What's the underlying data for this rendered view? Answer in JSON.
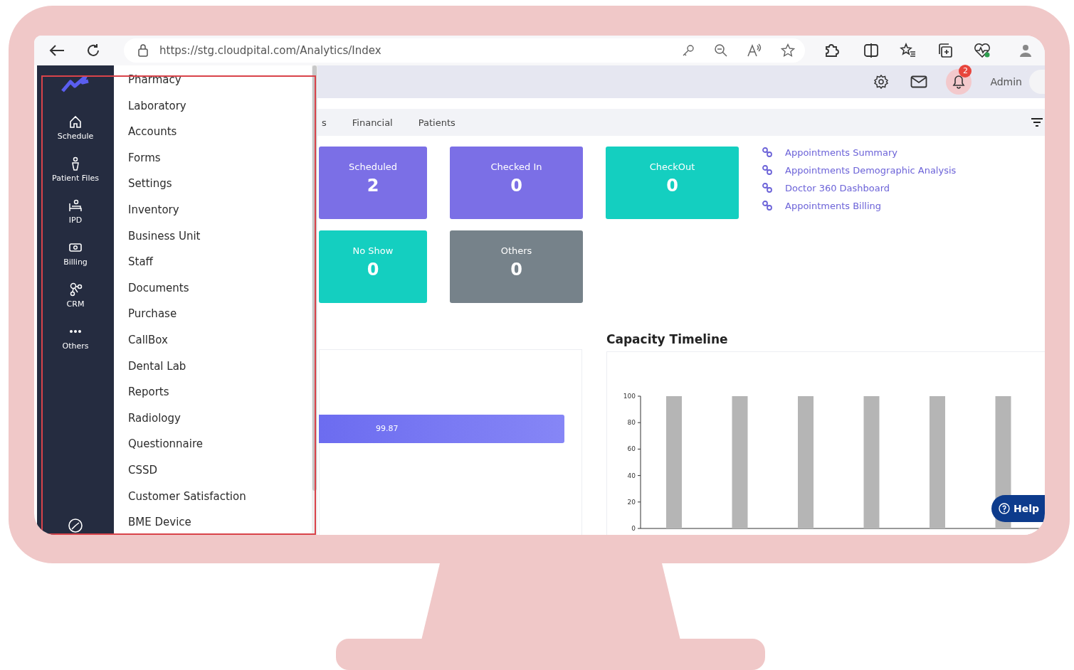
{
  "browser": {
    "url": "https://stg.cloudpital.com/Analytics/Index"
  },
  "sidebar": {
    "items": [
      {
        "label": "Schedule"
      },
      {
        "label": "Patient Files"
      },
      {
        "label": "IPD"
      },
      {
        "label": "Billing"
      },
      {
        "label": "CRM"
      },
      {
        "label": "Others"
      }
    ]
  },
  "menu": {
    "items": [
      "Pharmacy",
      "Laboratory",
      "Accounts",
      "Forms",
      "Settings",
      "Inventory",
      "Business Unit",
      "Staff",
      "Documents",
      "Purchase",
      "CallBox",
      "Dental Lab",
      "Reports",
      "Radiology",
      "Questionnaire",
      "CSSD",
      "Customer Satisfaction",
      "BME Device"
    ]
  },
  "header": {
    "notification_count": "2",
    "user": "Admin"
  },
  "tabs": [
    {
      "label": "s",
      "selected": false
    },
    {
      "label": "Financial",
      "selected": false
    },
    {
      "label": "Patients",
      "selected": false
    }
  ],
  "cards": [
    {
      "label": "Scheduled",
      "value": "2",
      "color": "#7b6fe6"
    },
    {
      "label": "Checked In",
      "value": "0",
      "color": "#7b6fe6"
    },
    {
      "label": "CheckOut",
      "value": "0",
      "color": "#14cfc0"
    },
    {
      "label": "No Show",
      "value": "0",
      "color": "#14cfc0"
    },
    {
      "label": "Others",
      "value": "0",
      "color": "#76828a"
    }
  ],
  "links": [
    "Appointments Summary",
    "Appointments Demographic Analysis",
    "Doctor 360 Dashboard",
    "Appointments Billing"
  ],
  "left_panel": {
    "bar_label": "99.87"
  },
  "capacity_timeline": {
    "title": "Capacity Timeline",
    "chart_data": {
      "type": "bar",
      "series": [
        {
          "color": "#b5b5b5",
          "values": [
            100,
            100,
            100,
            100,
            100,
            100
          ]
        }
      ],
      "ylim": [
        0,
        100
      ],
      "yticks": [
        0,
        20,
        40,
        60,
        80,
        100
      ]
    }
  },
  "help": {
    "label": "Help"
  }
}
